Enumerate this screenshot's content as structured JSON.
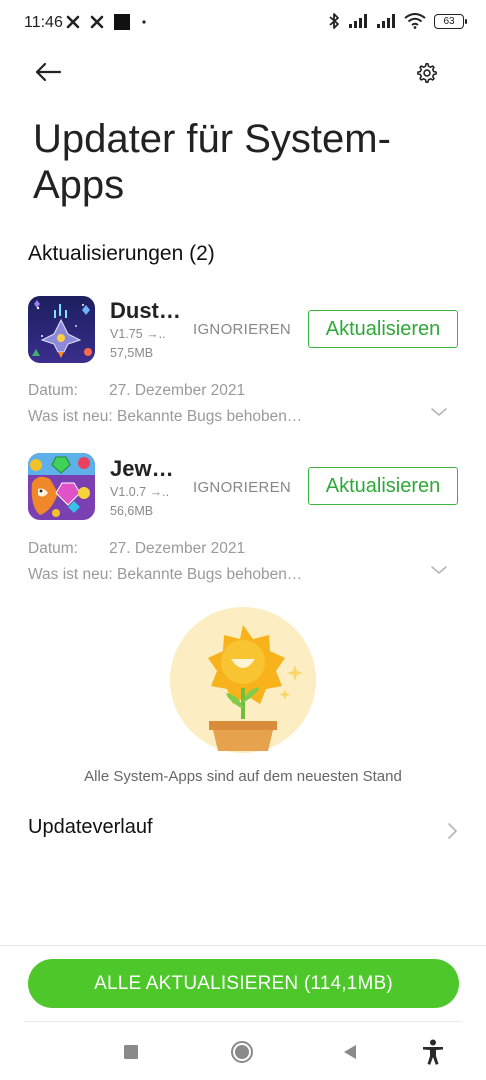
{
  "status_bar": {
    "time": "11:46",
    "battery": "63"
  },
  "header": {
    "title": "Updater für System-Apps"
  },
  "updates": {
    "heading": "Aktualisierungen (2)",
    "items": [
      {
        "name": "Dust…",
        "version": "V1.75 →..",
        "size": "57,5MB",
        "ignore_label": "IGNORIEREN",
        "update_label": "Aktualisieren",
        "date_label": "Datum:",
        "date_value": "27. Dezember 2021",
        "whatsnew_label": "Was ist neu:",
        "whatsnew_value": "Bekannte Bugs behoben…",
        "icon": "space-shooter-game-icon"
      },
      {
        "name": "Jew…",
        "version": "V1.0.7 →..",
        "size": "56,6MB",
        "ignore_label": "IGNORIEREN",
        "update_label": "Aktualisieren",
        "date_label": "Datum:",
        "date_value": "27. Dezember 2021",
        "whatsnew_label": "Was ist neu:",
        "whatsnew_value": "Bekannte Bugs behoben…",
        "icon": "jewel-fox-game-icon"
      }
    ]
  },
  "up_to_date": {
    "message": "Alle System-Apps sind auf dem neuesten Stand"
  },
  "history": {
    "label": "Updateverlauf"
  },
  "footer": {
    "update_all_label": "ALLE AKTUALISIEREN (114,1MB)"
  },
  "colors": {
    "accent_green": "#4ec72b",
    "outline_green": "#3cb53c",
    "illustration_bg": "#fcedc2",
    "sun_yellow": "#f8b21c"
  }
}
